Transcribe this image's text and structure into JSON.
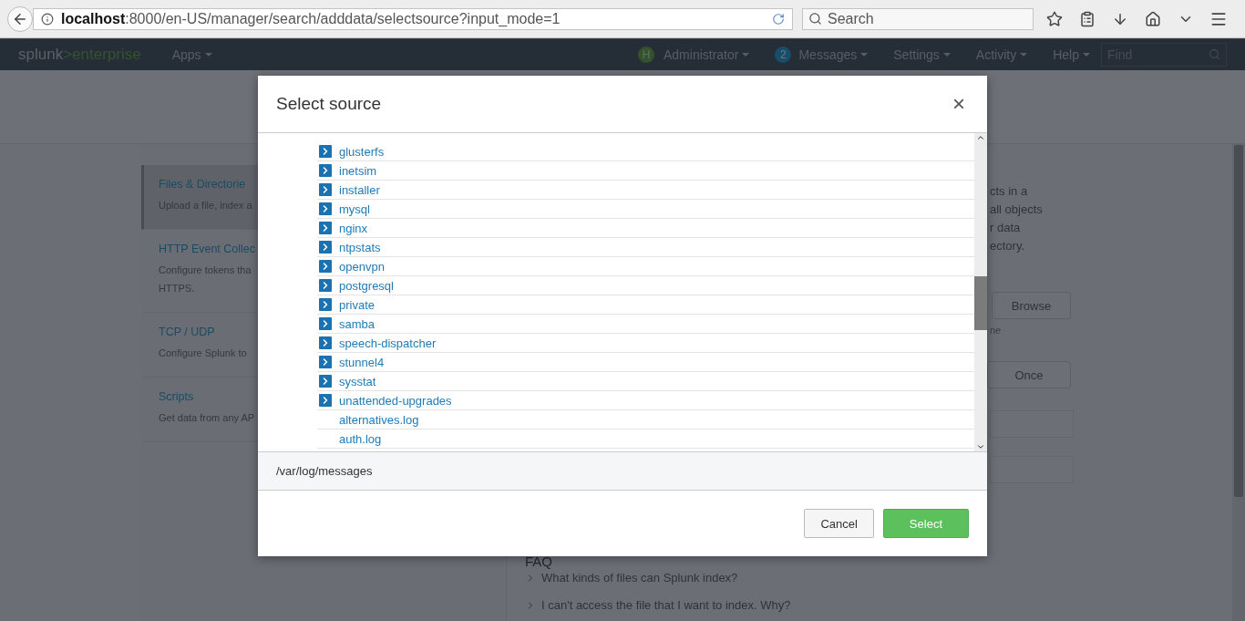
{
  "browser": {
    "url_host": "localhost",
    "url_rest": ":8000/en-US/manager/search/adddata/selectsource?input_mode=1",
    "search_placeholder": "Search"
  },
  "app_bar": {
    "logo_primary": "splunk",
    "logo_secondary": ">enterprise",
    "apps_menu": "Apps",
    "user_initial": "H",
    "user_name": "Administrator",
    "messages_count": "2",
    "messages_label": "Messages",
    "menus": [
      "Settings",
      "Activity",
      "Help"
    ],
    "find_placeholder": "Find"
  },
  "sidebar": {
    "items": [
      {
        "title": "Files & Directorie",
        "description": [
          "Upload a file, index a"
        ],
        "selected": true
      },
      {
        "title": "HTTP Event Collec",
        "description": [
          "Configure tokens tha",
          "HTTPS."
        ],
        "selected": false
      },
      {
        "title": "TCP / UDP",
        "description": [
          "Configure Splunk to"
        ],
        "selected": false
      },
      {
        "title": "Scripts",
        "description": [
          "Get data from any AP"
        ],
        "selected": false
      }
    ]
  },
  "main": {
    "description_lines": [
      "cts in a",
      "all objects",
      "r data",
      "ectory."
    ],
    "browse_button": "Browse",
    "hint": "ne",
    "once_button": "Once",
    "faq_title": "FAQ",
    "faq_items": [
      "What kinds of files can Splunk index?",
      "I can't access the file that I want to index. Why?"
    ]
  },
  "modal": {
    "title": "Select source",
    "close": "×",
    "tree": [
      {
        "name": "glusterfs",
        "kind": "folder"
      },
      {
        "name": "inetsim",
        "kind": "folder"
      },
      {
        "name": "installer",
        "kind": "folder"
      },
      {
        "name": "mysql",
        "kind": "folder"
      },
      {
        "name": "nginx",
        "kind": "folder"
      },
      {
        "name": "ntpstats",
        "kind": "folder"
      },
      {
        "name": "openvpn",
        "kind": "folder"
      },
      {
        "name": "postgresql",
        "kind": "folder"
      },
      {
        "name": "private",
        "kind": "folder"
      },
      {
        "name": "samba",
        "kind": "folder"
      },
      {
        "name": "speech-dispatcher",
        "kind": "folder"
      },
      {
        "name": "stunnel4",
        "kind": "folder"
      },
      {
        "name": "sysstat",
        "kind": "folder"
      },
      {
        "name": "unattended-upgrades",
        "kind": "folder"
      },
      {
        "name": "alternatives.log",
        "kind": "file"
      },
      {
        "name": "auth.log",
        "kind": "file"
      }
    ],
    "selected_path": "/var/log/messages",
    "buttons": [
      {
        "label": "Cancel",
        "kind": "secondary"
      },
      {
        "label": "Select",
        "kind": "primary"
      }
    ]
  }
}
